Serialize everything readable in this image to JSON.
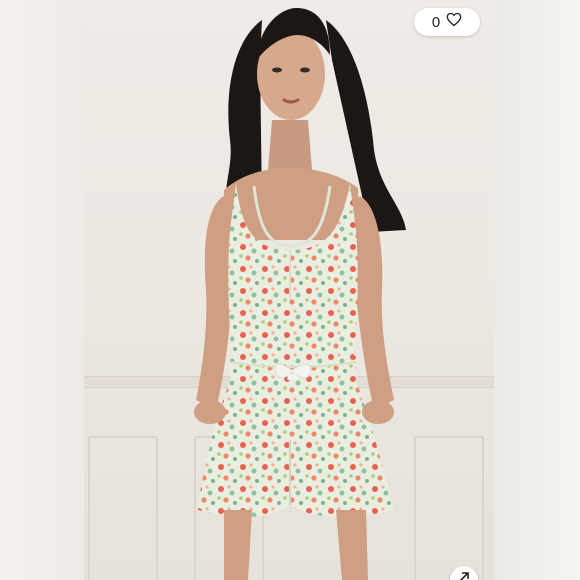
{
  "listing": {
    "like_count": "0",
    "like_icon": "heart-outline-icon",
    "expand_icon": "arrow-up-right-icon"
  },
  "colors": {
    "accent": "#e9624f",
    "print_green": "#8fc1a1",
    "background": "#f6f4f1"
  }
}
